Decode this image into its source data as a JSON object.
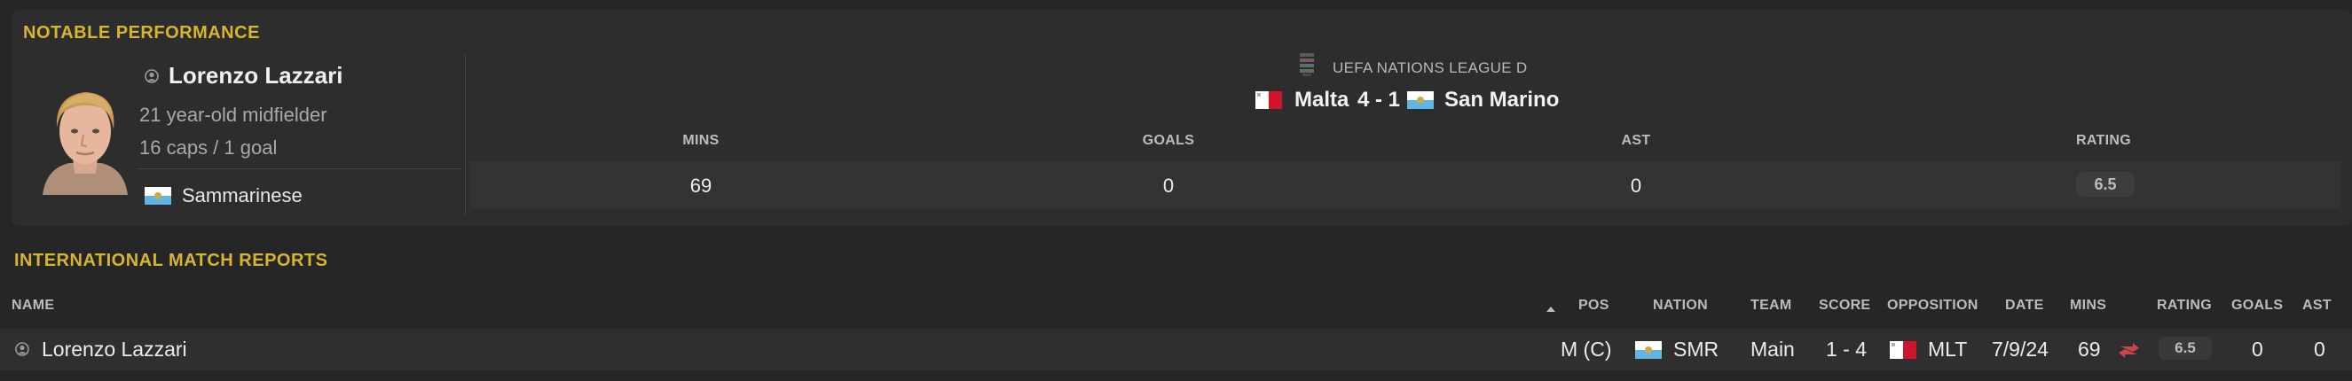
{
  "notable": {
    "section_title": "NOTABLE PERFORMANCE",
    "player": {
      "name": "Lorenzo Lazzari",
      "age_position": "21 year-old midfielder",
      "caps_goals": "16 caps / 1 goal",
      "nationality": "Sammarinese"
    },
    "match": {
      "competition": "UEFA NATIONS LEAGUE D",
      "home_team": "Malta",
      "score": "4 - 1",
      "away_team": "San Marino"
    },
    "stats": {
      "headers": [
        "MINS",
        "GOALS",
        "AST",
        "RATING"
      ],
      "mins": "69",
      "goals": "0",
      "ast": "0",
      "rating": "6.5"
    }
  },
  "reports": {
    "section_title": "INTERNATIONAL MATCH REPORTS",
    "columns": {
      "name": "NAME",
      "pos": "POS",
      "nation": "NATION",
      "team": "TEAM",
      "score": "SCORE",
      "opposition": "OPPOSITION",
      "date": "DATE",
      "mins": "MINS",
      "rating": "RATING",
      "goals": "GOALS",
      "ast": "AST"
    },
    "rows": [
      {
        "name": "Lorenzo Lazzari",
        "pos": "M (C)",
        "nation": "SMR",
        "team": "Main",
        "score": "1 - 4",
        "opposition": "MLT",
        "date": "7/9/24",
        "mins": "69",
        "rating": "6.5",
        "goals": "0",
        "ast": "0"
      }
    ]
  },
  "colors": {
    "accent": "#d6b531",
    "background": "#262626",
    "panel": "#2d2d2d"
  },
  "icons": [
    "person-icon",
    "san-marino-flag-icon",
    "malta-flag-icon",
    "competition-logo-icon",
    "sort-up-icon",
    "substitution-icon"
  ]
}
